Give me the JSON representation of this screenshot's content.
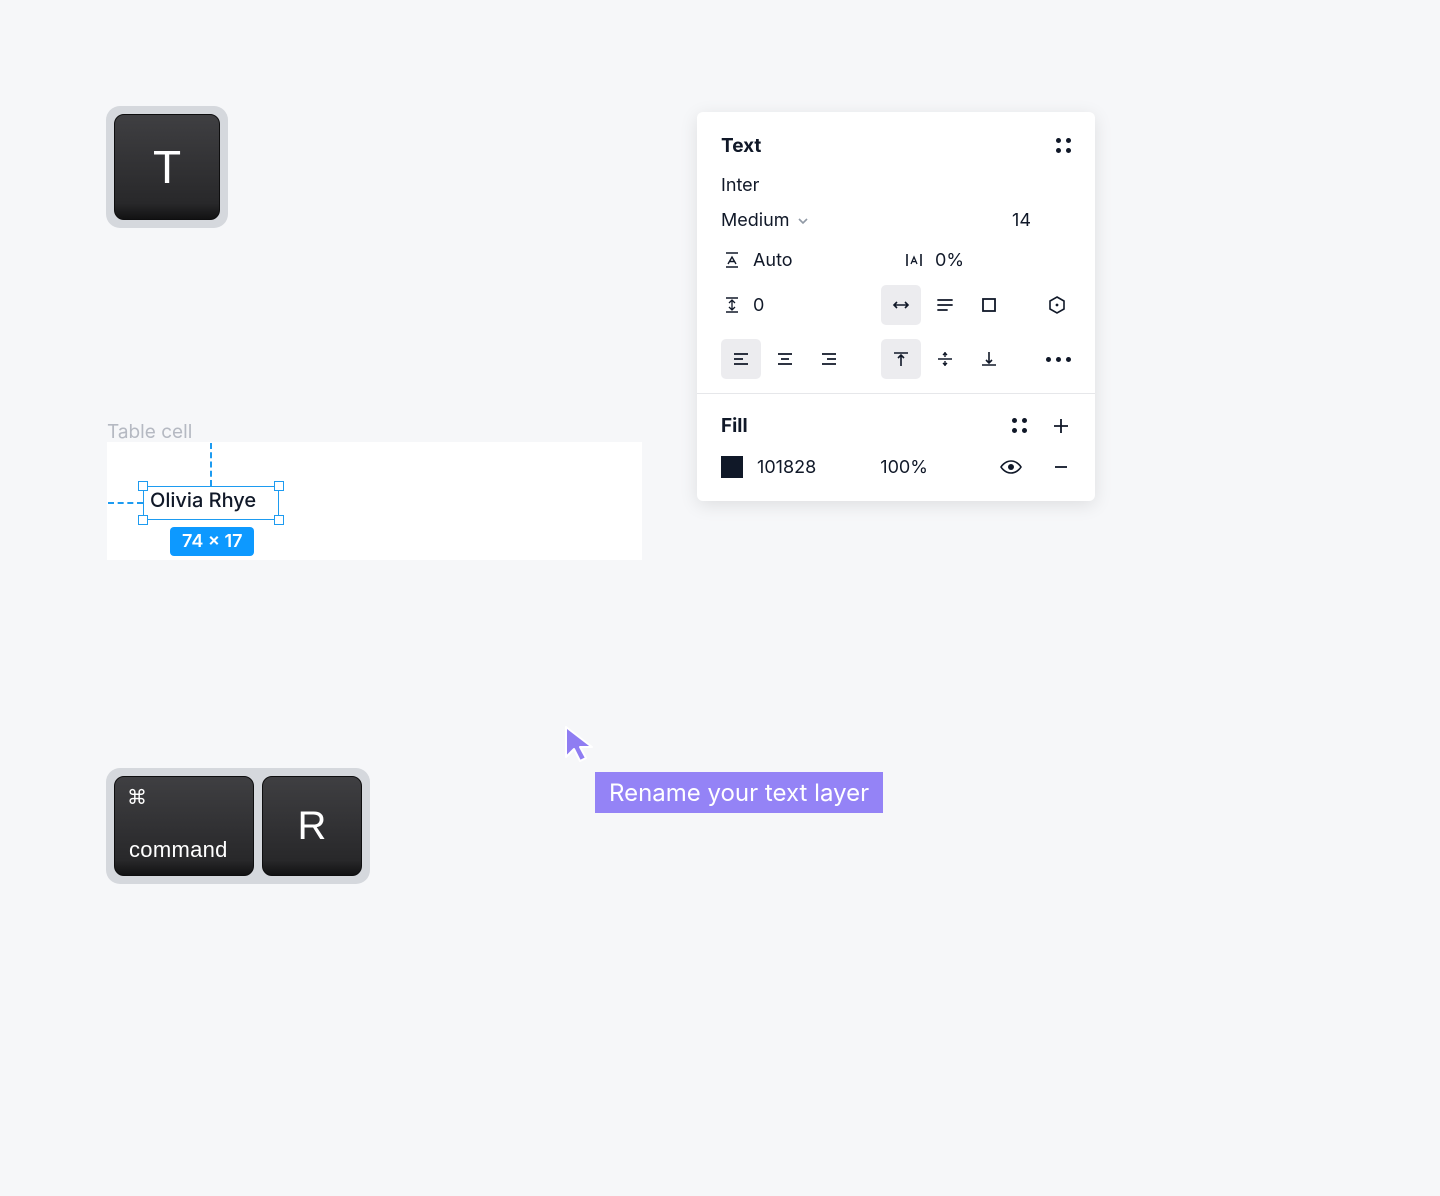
{
  "key_t": {
    "label": "T"
  },
  "preview": {
    "frame_label": "Table cell",
    "text": "Olivia Rhye",
    "dimensions": "74 × 17"
  },
  "panel": {
    "text": {
      "title": "Text",
      "font_family": "Inter",
      "weight": "Medium",
      "size": "14",
      "line_height": "Auto",
      "letter_spacing": "0%",
      "paragraph_spacing": "0"
    },
    "fill": {
      "title": "Fill",
      "color_hex": "101828",
      "opacity": "100%"
    }
  },
  "key_combo": {
    "cmd_symbol": "⌘",
    "cmd_label": "command",
    "r_label": "R"
  },
  "tooltip": {
    "text": "Rename your text layer"
  }
}
